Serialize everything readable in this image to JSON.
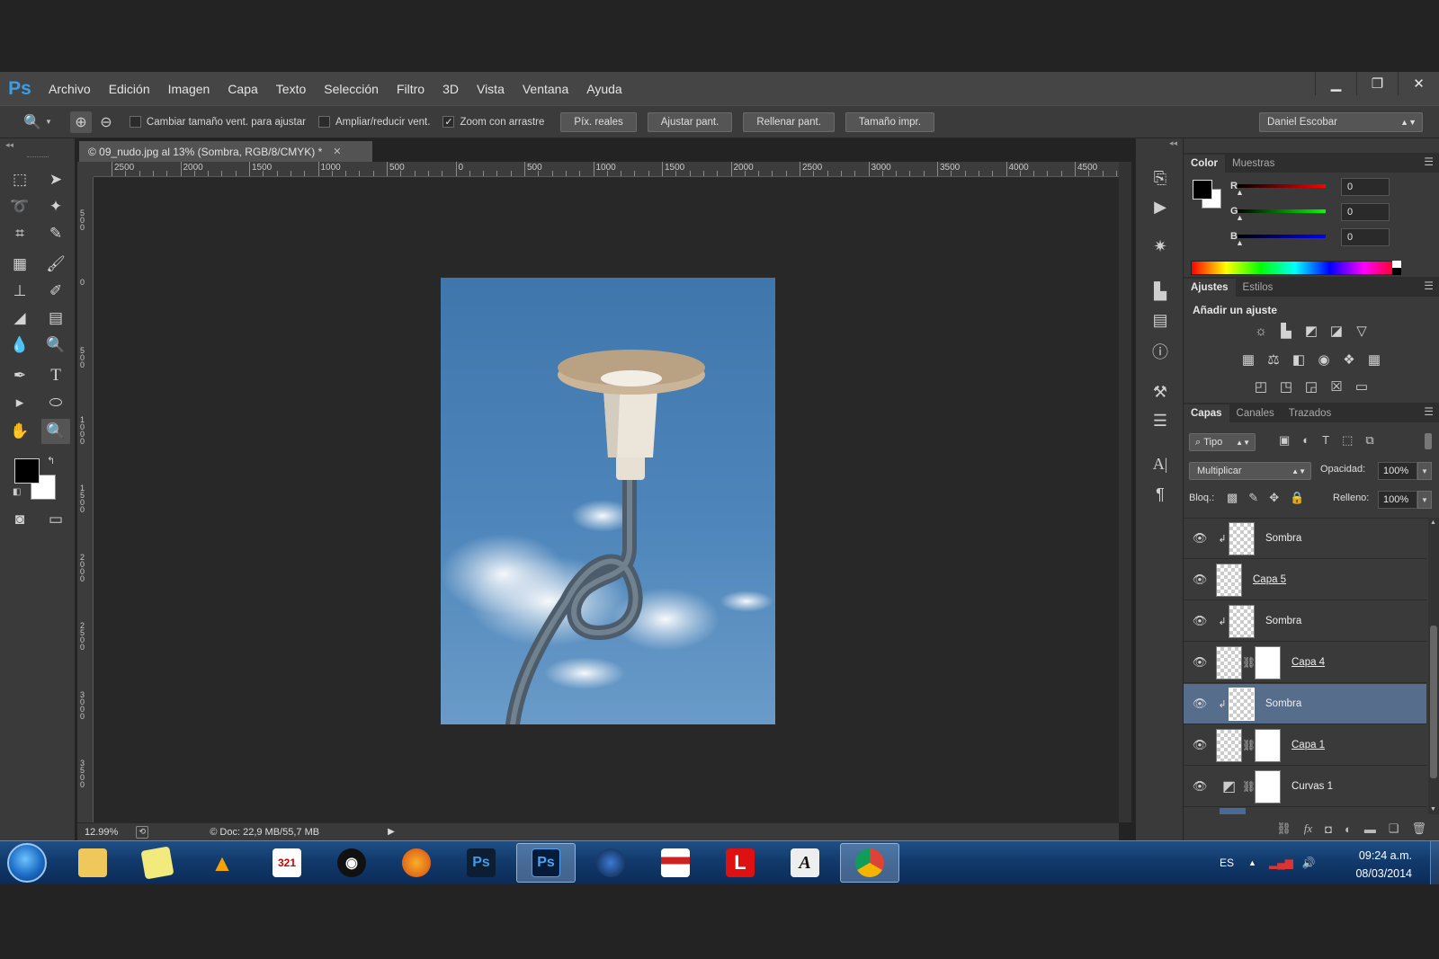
{
  "app": {
    "logo": "Ps"
  },
  "menu": [
    "Archivo",
    "Edición",
    "Imagen",
    "Capa",
    "Texto",
    "Selección",
    "Filtro",
    "3D",
    "Vista",
    "Ventana",
    "Ayuda"
  ],
  "window_controls": [
    "minimize-icon",
    "restore-icon",
    "close-icon"
  ],
  "options": {
    "resize_windows_label": "Cambiar tamaño vent. para ajustar",
    "resize_windows_checked": false,
    "zoom_all_label": "Ampliar/reducir vent.",
    "zoom_all_checked": false,
    "scrubby_label": "Zoom con arrastre",
    "scrubby_checked": true,
    "btn_actual_pixels": "Píx. reales",
    "btn_fit_screen": "Ajustar pant.",
    "btn_fill_screen": "Rellenar pant.",
    "btn_print_size": "Tamaño impr.",
    "workspace_user": "Daniel Escobar"
  },
  "document": {
    "tab_title": "© 09_nudo.jpg al 13% (Sombra, RGB/8/CMYK) *",
    "ruler_top": [
      "2500",
      "2000",
      "1500",
      "1000",
      "500",
      "0",
      "500",
      "1000",
      "1500",
      "2000",
      "2500",
      "3000",
      "3500",
      "4000",
      "4500"
    ],
    "ruler_left": [
      "5 0 0",
      "0",
      "5 0 0",
      "1 0 0 0",
      "1 5 0 0",
      "2 0 0 0",
      "2 5 0 0",
      "3 0 0 0",
      "3 5 0 0"
    ],
    "zoom": "12.99%",
    "doc_info": "Doc: 22,9 MB/55,7 MB"
  },
  "color_panel": {
    "tabs": [
      "Color",
      "Muestras"
    ],
    "channels": [
      {
        "label": "R",
        "value": "0",
        "color": "#e02020"
      },
      {
        "label": "G",
        "value": "0",
        "color": "#20c020"
      },
      {
        "label": "B",
        "value": "0",
        "color": "#2040e0"
      }
    ]
  },
  "adjustments_panel": {
    "tabs": [
      "Ajustes",
      "Estilos"
    ],
    "heading": "Añadir un ajuste"
  },
  "layers_panel": {
    "tabs": [
      "Capas",
      "Canales",
      "Trazados"
    ],
    "filter_kind": "Tipo",
    "blend_mode": "Multiplicar",
    "opacity_label": "Opacidad:",
    "opacity_value": "100%",
    "lock_label": "Bloq.:",
    "fill_label": "Relleno:",
    "fill_value": "100%",
    "layers": [
      {
        "name": "Sombra",
        "clipped": true,
        "mask": false,
        "selected": false,
        "underline": false
      },
      {
        "name": "Capa 5",
        "clipped": false,
        "mask": false,
        "selected": false,
        "underline": true
      },
      {
        "name": "Sombra",
        "clipped": true,
        "mask": false,
        "selected": false,
        "underline": false
      },
      {
        "name": "Capa 4",
        "clipped": false,
        "mask": true,
        "selected": false,
        "underline": true
      },
      {
        "name": "Sombra",
        "clipped": true,
        "mask": false,
        "selected": true,
        "underline": false
      },
      {
        "name": "Capa 1",
        "clipped": false,
        "mask": true,
        "selected": false,
        "underline": true
      },
      {
        "name": "Curvas 1",
        "clipped": false,
        "mask": true,
        "selected": false,
        "underline": false
      }
    ]
  },
  "taskbar": {
    "language": "ES",
    "time": "09:24 a.m.",
    "date": "08/03/2014"
  }
}
